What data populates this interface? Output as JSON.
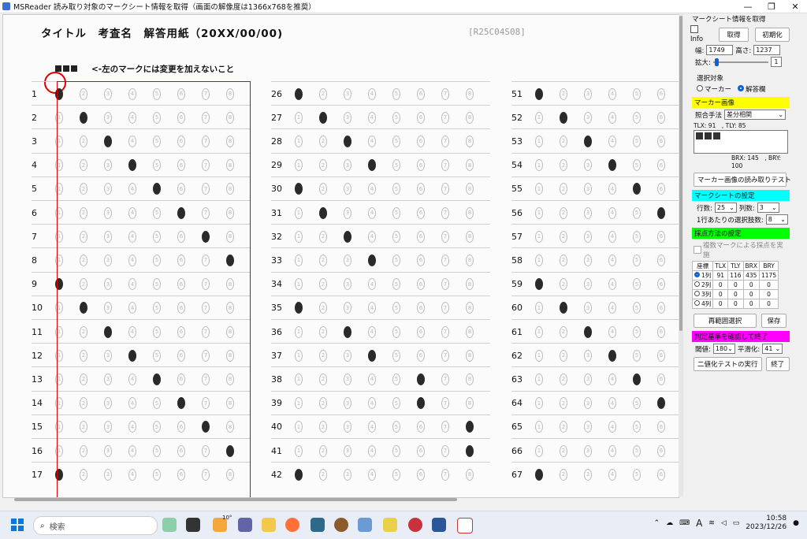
{
  "window": {
    "title": "MSReader 読み取り対象のマークシート情報を取得（画面の解像度は1366x768を推奨）",
    "min_glyph": "—",
    "max_glyph": "❐",
    "close_glyph": "✕"
  },
  "sheet": {
    "title": "タイトル　考査名　解答用紙（20XX/00/00)",
    "code": "[R25C04S08]",
    "marker_note": "<-左のマークには変更を加えないこと",
    "columns": [
      {
        "start": 1,
        "rows": [
          1,
          2,
          3,
          4,
          5,
          6,
          7,
          8,
          1,
          2,
          3,
          4,
          5,
          6,
          7,
          8,
          1
        ]
      },
      {
        "start": 26,
        "rows": [
          1,
          2,
          3,
          4,
          1,
          2,
          3,
          4,
          0,
          1,
          3,
          4,
          6,
          6,
          8,
          8,
          1
        ]
      },
      {
        "start": 51,
        "rows": [
          1,
          2,
          3,
          4,
          5,
          6,
          7,
          8,
          1,
          2,
          3,
          4,
          5,
          6,
          8,
          8,
          1
        ]
      }
    ],
    "bubble_labels": [
      "1",
      "2",
      "3",
      "4",
      "5",
      "6",
      "7",
      "8"
    ]
  },
  "panel": {
    "title": "マークシート情報を取得",
    "info_label": "Info",
    "get_button": "取得",
    "init_button": "初期化",
    "width_label": "幅:",
    "width_value": "1749",
    "height_label": "高さ:",
    "height_value": "1237",
    "zoom_label": "拡大:",
    "zoom_value": "1",
    "select_target_label": "選択対象",
    "radio_marker": "マーカー",
    "radio_answer": "解答欄",
    "marker_image_header": "マーカー画像",
    "match_label": "照合手法",
    "match_value": "差分相関",
    "tl_label": "TLX: 91　, TLY: 85",
    "br_label": "BRX: 145　, BRY: 100",
    "marker_test_button": "マーカー画像の読み取りテスト",
    "sheet_settings_header": "マークシートの設定",
    "rows_label": "行数:",
    "rows_value": "25",
    "cols_label": "列数:",
    "cols_value": "3",
    "choices_label": "1行あたりの選択肢数:",
    "choices_value": "8",
    "scoring_header": "採点方法の設定",
    "multi_mark_label": "複数マークによる採点を実施",
    "coord_headers": [
      "座標",
      "TLX",
      "TLY",
      "BRX",
      "BRY"
    ],
    "coord_rows": [
      [
        "1列",
        "91",
        "116",
        "435",
        "1175"
      ],
      [
        "2列",
        "0",
        "0",
        "0",
        "0"
      ],
      [
        "3列",
        "0",
        "0",
        "0",
        "0"
      ],
      [
        "4列",
        "0",
        "0",
        "0",
        "0"
      ]
    ],
    "reselect_button": "再範囲選択",
    "save_button": "保存",
    "criteria_header": "判定基準を確認して終了",
    "threshold_label": "閾値:",
    "threshold_value": "180",
    "smooth_label": "平滑化:",
    "smooth_value": "41",
    "binarize_button": "二値化テストの実行",
    "finish_button": "終了",
    "colors": {
      "yellow": "#ffff00",
      "cyan": "#00ffff",
      "green": "#00ff00",
      "magenta": "#ff00ff"
    }
  },
  "taskbar": {
    "search_placeholder": "検索",
    "time": "10:58",
    "date": "2023/12/26",
    "ime": "A",
    "weather_badge": "10°"
  }
}
